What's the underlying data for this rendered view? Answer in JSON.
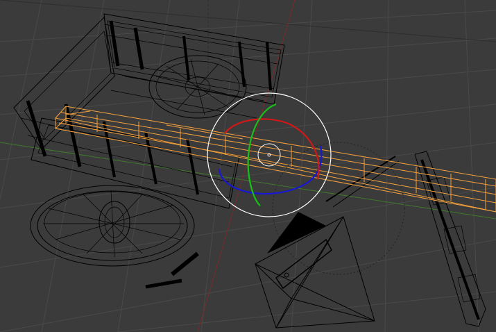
{
  "viewport": {
    "background": "#3b3b3b",
    "grid_color": "#4a4a4a",
    "axis_x_color": "#7a2a2a",
    "axis_y_color": "#3f7a2a"
  },
  "objects": {
    "cart": {
      "label": "cart",
      "wire_color": "#000000",
      "selected": false
    },
    "shaft": {
      "label": "shaft",
      "wire_color": "#f7a23d",
      "selected": true
    },
    "camera": {
      "label": "camera",
      "wire_color": "#000000",
      "selected": false
    }
  },
  "gizmo": {
    "mode": "rotate",
    "colors": {
      "x": "#d01818",
      "y": "#18c018",
      "z": "#1818d0",
      "view": "#ffffff"
    }
  }
}
